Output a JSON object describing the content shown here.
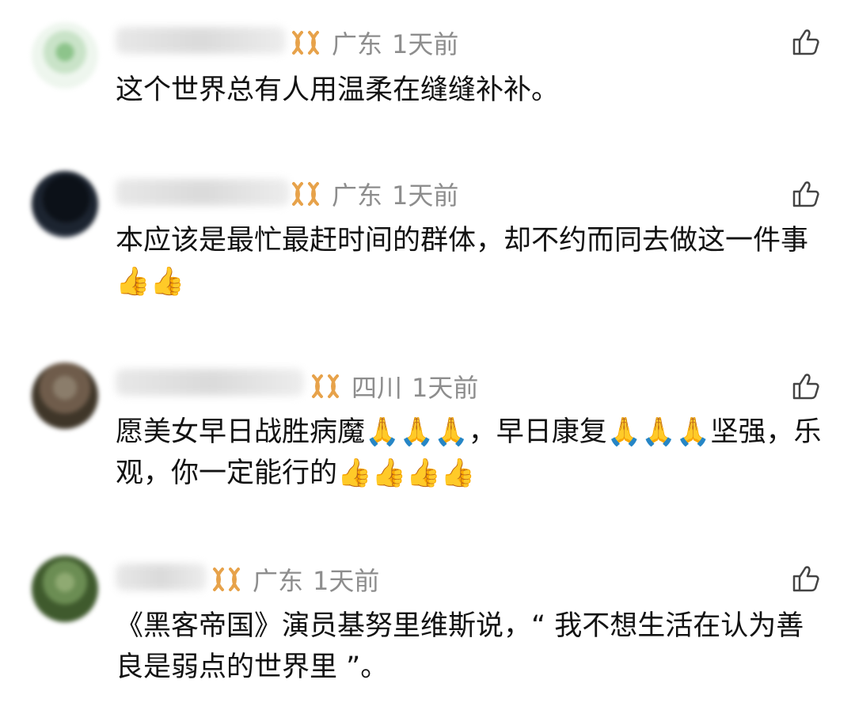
{
  "comments": [
    {
      "location": "广东",
      "time": "1天前",
      "text": "这个世界总有人用温柔在缝缝补补。"
    },
    {
      "location": "广东",
      "time": "1天前",
      "text": "本应该是最忙最赶时间的群体，却不约而同去做这一件事👍👍"
    },
    {
      "location": "四川",
      "time": "1天前",
      "text": "愿美女早日战胜病魔🙏🙏🙏，早日康复🙏🙏🙏坚强，乐观，你一定能行的👍👍👍👍"
    },
    {
      "location": "广东",
      "time": "1天前",
      "text": "《黑客帝国》演员基努里维斯说，“ 我不想生活在认为善良是弱点的世界里 ”。"
    }
  ],
  "icons": {
    "badge": "gold-knot-icon",
    "like": "thumbs-up-icon"
  },
  "colors": {
    "meta": "#8d8d8d",
    "text": "#121212",
    "badge": "#e7a24a"
  }
}
